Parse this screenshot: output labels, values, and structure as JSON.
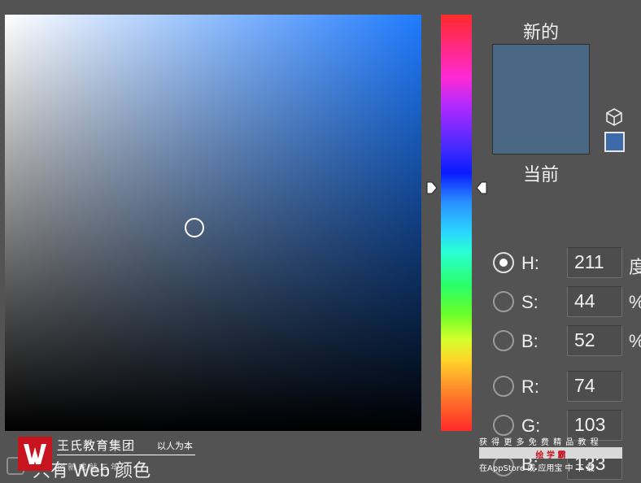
{
  "preview": {
    "new_label": "新的",
    "current_label": "当前",
    "new_color": "#4a6784",
    "current_color": "#4a6784",
    "web_swatch_color": "#3f6aa9"
  },
  "hsb": {
    "h": {
      "label": "H:",
      "value": "211",
      "unit": "度",
      "selected": true
    },
    "s": {
      "label": "S:",
      "value": "44",
      "unit": "%"
    },
    "b": {
      "label": "B:",
      "value": "52",
      "unit": "%"
    }
  },
  "rgb": {
    "r": {
      "label": "R:",
      "value": "74"
    },
    "g": {
      "label": "G:",
      "value": "103"
    },
    "b": {
      "label": "B:",
      "value": "133"
    }
  },
  "web_only": {
    "label": "只有 Web 颜色",
    "checked": false
  },
  "watermark1": {
    "title": "王氏教育集团",
    "slogan": "以人为本",
    "tagline": "创  新  成  就  二  年"
  },
  "watermark2": {
    "line1": "获 得 更 多 免 费 精 品 教 程",
    "line2": "绘 学 霸",
    "line3": "在AppStore 或 应用宝 中 下 载"
  }
}
